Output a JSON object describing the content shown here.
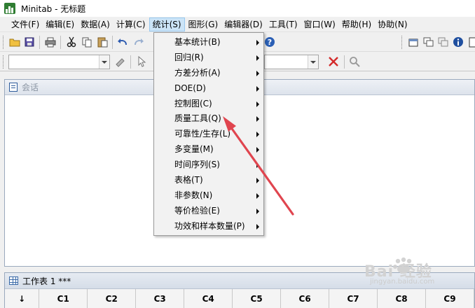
{
  "window": {
    "title": "Minitab - 无标题"
  },
  "menubar": {
    "items": [
      {
        "label": "文件(F)",
        "width": 54
      },
      {
        "label": "编辑(E)",
        "width": 51
      },
      {
        "label": "数据(A)",
        "width": 51
      },
      {
        "label": "计算(C)",
        "width": 51
      },
      {
        "label": "统计(S)",
        "width": 51,
        "active": true
      },
      {
        "label": "图形(G)",
        "width": 51
      },
      {
        "label": "编辑器(D)",
        "width": 63
      },
      {
        "label": "工具(T)",
        "width": 51
      },
      {
        "label": "窗口(W)",
        "width": 55
      },
      {
        "label": "帮助(H)",
        "width": 51
      },
      {
        "label": "协助(N)",
        "width": 51
      }
    ]
  },
  "stat_menu": {
    "items": [
      "基本统计(B)",
      "回归(R)",
      "方差分析(A)",
      "DOE(D)",
      "控制图(C)",
      "质量工具(Q)",
      "可靠性/生存(L)",
      "多变量(M)",
      "时间序列(S)",
      "表格(T)",
      "非参数(N)",
      "等价检验(E)",
      "功效和样本数量(P)"
    ]
  },
  "session": {
    "title": "会话"
  },
  "worksheet": {
    "title": "工作表 1 ***",
    "first_col": "↓",
    "columns": [
      "C1",
      "C2",
      "C3",
      "C4",
      "C5",
      "C6",
      "C7",
      "C8",
      "C9"
    ]
  },
  "watermark": {
    "text": "Bai 经验",
    "url": "jingyan.baidu.com"
  },
  "colors": {
    "menu_active_bg": "#cce4f7",
    "annotation_arrow": "#e0454f",
    "app_icon": "#2f7d32"
  }
}
